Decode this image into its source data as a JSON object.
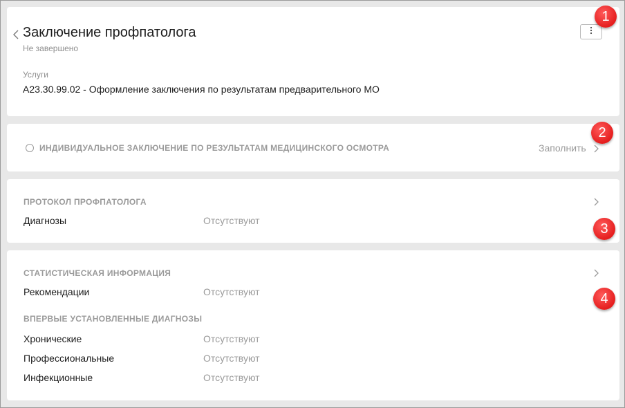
{
  "header": {
    "title": "Заключение профпатолога",
    "status": "Не завершено",
    "services_label": "Услуги",
    "services_value": "A23.30.99.02 - Оформление заключения по результатам предварительного МО",
    "menu_icon": "more-vertical-icon"
  },
  "conclusion": {
    "title": "ИНДИВИДУАЛЬНОЕ ЗАКЛЮЧЕНИЕ ПО РЕЗУЛЬТАТАМ МЕДИЦИНСКОГО ОСМОТРА",
    "action_label": "Заполнить"
  },
  "protocol": {
    "title": "ПРОТОКОЛ ПРОФПАТОЛОГА",
    "rows": [
      {
        "label": "Диагнозы",
        "value": "Отсутствуют"
      }
    ]
  },
  "stats": {
    "title": "СТАТИСТИЧЕСКАЯ ИНФОРМАЦИЯ",
    "rows": [
      {
        "label": "Рекомендации",
        "value": "Отсутствуют"
      }
    ],
    "subsection_title": "ВПЕРВЫЕ УСТАНОВЛЕННЫЕ ДИАГНОЗЫ",
    "diagnoses": [
      {
        "label": "Хронические",
        "value": "Отсутствуют"
      },
      {
        "label": "Профессиональные",
        "value": "Отсутствуют"
      },
      {
        "label": "Инфекционные",
        "value": "Отсутствуют"
      }
    ]
  },
  "annotations": [
    "1",
    "2",
    "3",
    "4"
  ],
  "colors": {
    "badge": "#e51e1e",
    "muted_text": "#9a9a9a",
    "background": "#e9e9e9"
  }
}
